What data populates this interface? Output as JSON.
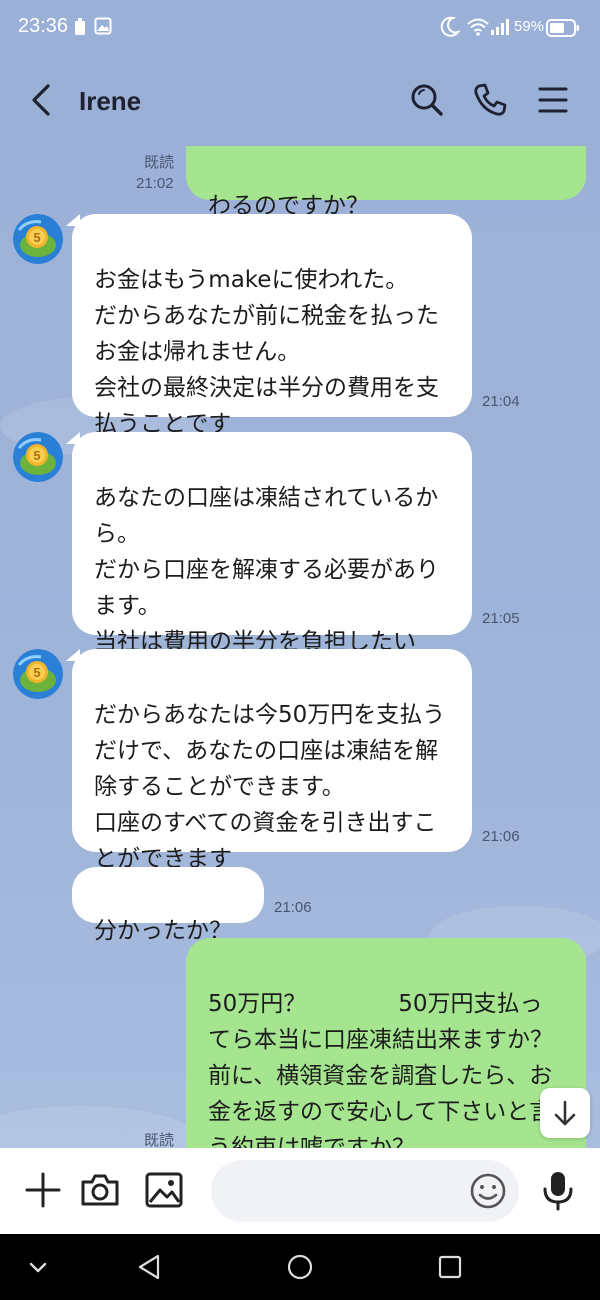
{
  "status_bar": {
    "time": "23:36",
    "battery_percent": "59%"
  },
  "header": {
    "contact_name": "Irene"
  },
  "messages": [
    {
      "side": "out",
      "text": "わるのですか？",
      "read_label": "既読",
      "time": "21:02"
    },
    {
      "side": "in",
      "text": "お金はもうmakeに使われた。\nだからあなたが前に税金を払ったお金は帰れません。\n会社の最終決定は半分の費用を支払うことです",
      "time": "21:04"
    },
    {
      "side": "in",
      "text": "あなたの口座は凍結されているから。\nだから口座を解凍する必要があります。\n当社は費用の半分を負担したい",
      "time": "21:05"
    },
    {
      "side": "in",
      "text": "だからあなたは今50万円を支払うだけで、あなたの口座は凍結を解除することができます。\n口座のすべての資金を引き出すことができます",
      "time": "21:06"
    },
    {
      "side": "in",
      "text": "分かったか？",
      "time": "21:06"
    },
    {
      "side": "out",
      "text": "50万円？　　　　50万円支払ってら本当に口座凍結出来ますか？\n前に、横領資金を調査したら、お金を返すので安心して下さいと言う約束は嘘ですか？",
      "read_label": "既読"
    }
  ],
  "input": {
    "placeholder": ""
  },
  "colors": {
    "background": "#9bb0d6",
    "outgoing_bubble": "#a6e58f",
    "incoming_bubble": "#ffffff"
  },
  "icons": [
    "back-icon",
    "search-icon",
    "phone-icon",
    "menu-icon",
    "plus-icon",
    "camera-icon",
    "image-icon",
    "emoji-icon",
    "mic-icon",
    "arrow-down-icon",
    "nav-down-icon",
    "nav-back-icon",
    "nav-home-icon",
    "nav-recents-icon"
  ]
}
